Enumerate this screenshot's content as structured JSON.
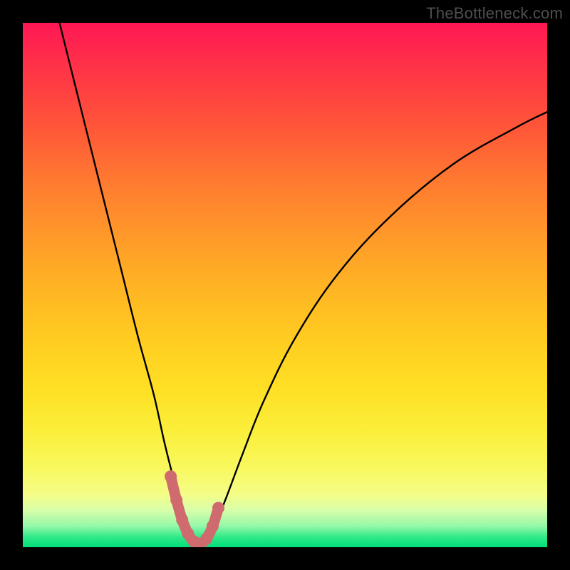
{
  "credit_text": "TheBottleneck.com",
  "colors": {
    "page_bg": "#000000",
    "curve_stroke": "#000000",
    "marker_stroke": "#cf6a6e",
    "gradient_top": "#ff1754",
    "gradient_bottom": "#00df7a"
  },
  "chart_data": {
    "type": "line",
    "title": "",
    "xlabel": "",
    "ylabel": "",
    "x_range": [
      0,
      100
    ],
    "y_range": [
      0,
      100
    ],
    "note": "x is horizontal position as % of plot width; y is bottleneck % (0 at bottom/green, 100 at top/red). Curve is a V shape with minimum near x≈33.",
    "series": [
      {
        "name": "bottleneck-curve",
        "x": [
          7,
          10,
          13,
          16,
          19,
          22,
          25,
          27,
          29,
          30.5,
          32,
          33,
          34,
          35.5,
          37,
          39,
          42,
          46,
          52,
          60,
          70,
          82,
          94,
          100
        ],
        "y": [
          100,
          88,
          76,
          64,
          52,
          40,
          29,
          20,
          12,
          6,
          2,
          0.5,
          0.5,
          2,
          5,
          10,
          18,
          28,
          40,
          52,
          63,
          73,
          80,
          83
        ]
      }
    ],
    "markers": {
      "name": "highlighted-segment",
      "x": [
        28.2,
        29.3,
        30.4,
        31.5,
        32.6,
        33.8,
        35.0,
        36.2,
        37.3
      ],
      "y": [
        13.5,
        9.0,
        5.2,
        2.6,
        1.1,
        0.7,
        1.6,
        4.0,
        7.5
      ]
    }
  }
}
